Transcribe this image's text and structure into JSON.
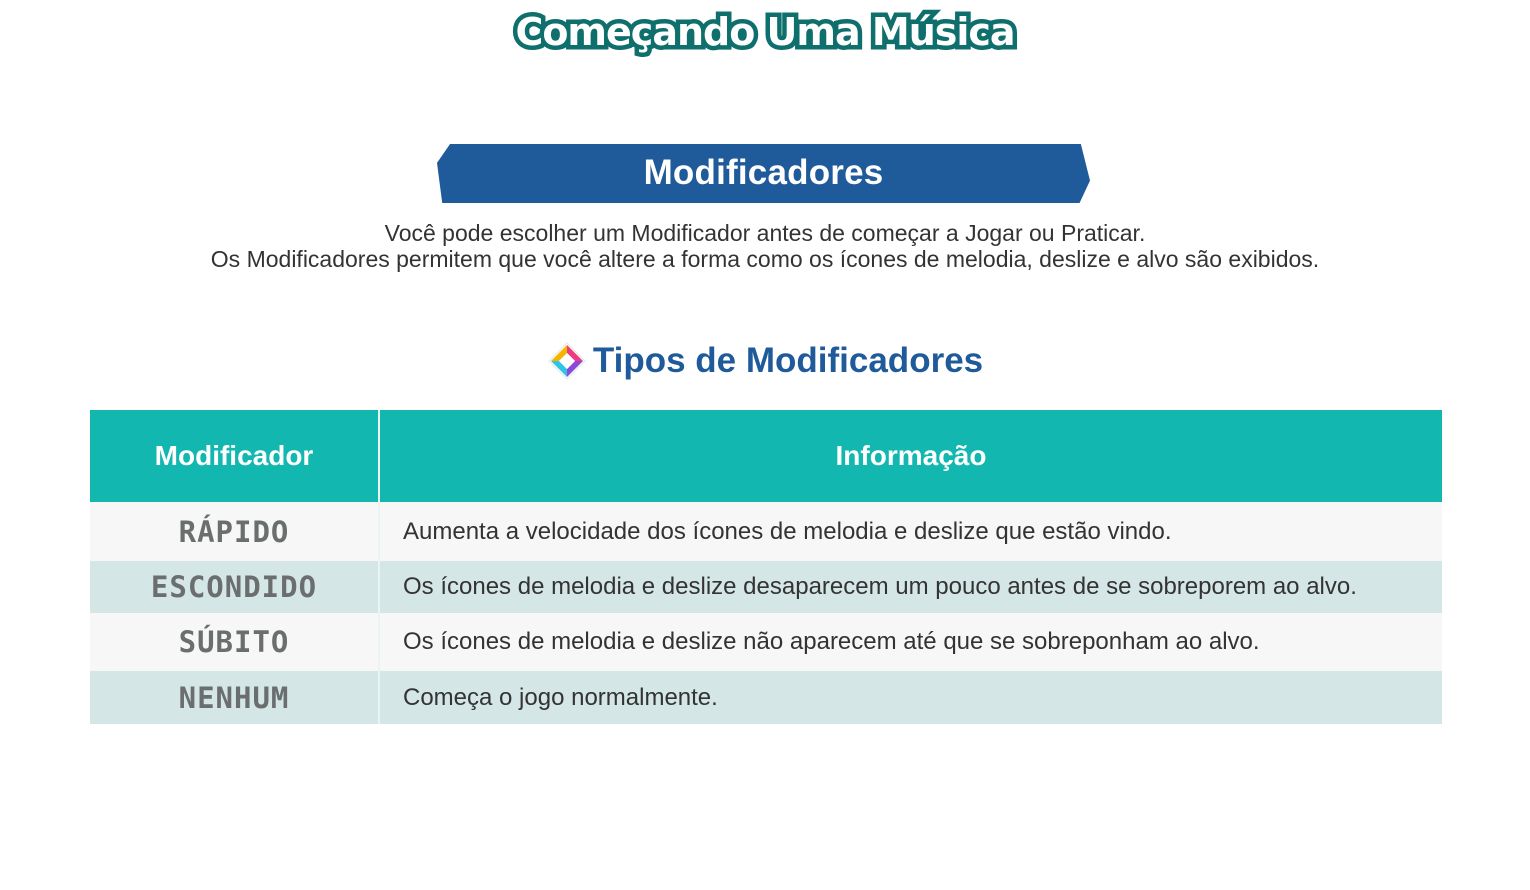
{
  "page_title": "Começando Uma Música",
  "section": {
    "title": "Modificadores",
    "intro_lines": [
      "Você pode escolher um Modificador antes de começar a Jogar ou Praticar.",
      "Os Modificadores permitem que você altere a forma como os ícones de melodia, deslize e alvo são exibidos."
    ],
    "subheading": "Tipos de Modificadores",
    "subheading_icon": "diamond-icon"
  },
  "table": {
    "headers": [
      "Modificador",
      "Informação"
    ],
    "rows": [
      {
        "name": "RÁPIDO",
        "info": "Aumenta a velocidade dos ícones de melodia e deslize que estão vindo."
      },
      {
        "name": "ESCONDIDO",
        "info": "Os ícones de melodia e deslize desaparecem um pouco antes de se sobreporem ao alvo."
      },
      {
        "name": "SÚBITO",
        "info": "Os ícones de melodia e deslize não aparecem até que se sobreponham ao alvo."
      },
      {
        "name": "NENHUM",
        "info": "Começa o jogo normalmente."
      }
    ]
  },
  "colors": {
    "title_stroke": "#0f6f6c",
    "banner": "#1f5a9a",
    "table_header": "#12b8b0",
    "row_light": "#f7f7f7",
    "row_tint": "#d4e6e5",
    "modifier_text": "#6b6e6e"
  }
}
